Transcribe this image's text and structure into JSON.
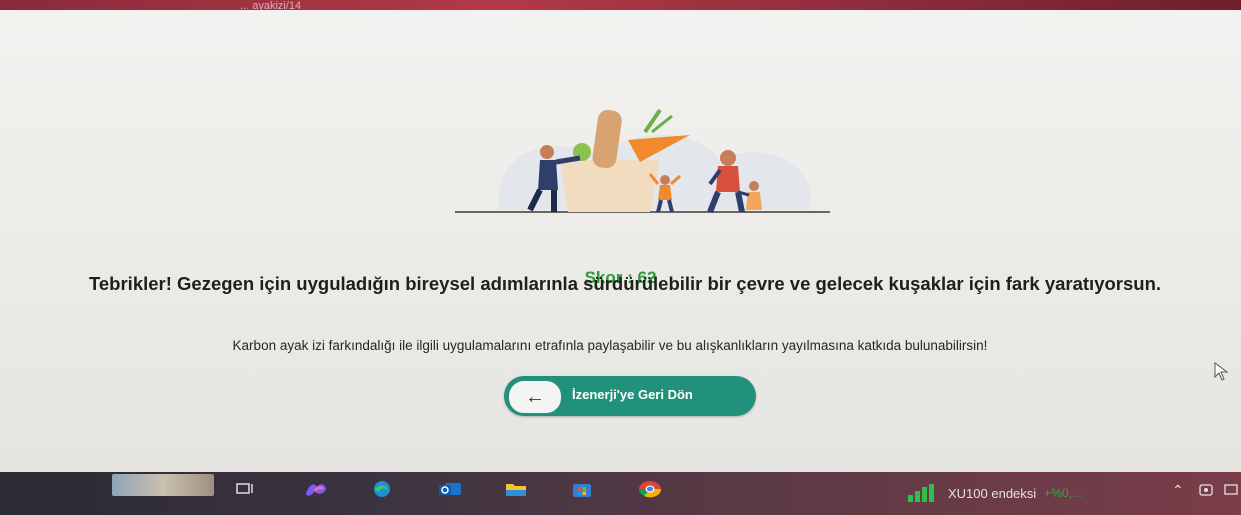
{
  "window": {
    "title": "... ayakizi/14"
  },
  "page": {
    "score_text": "Skor : 62",
    "headline": "Tebrikler! Gezegen için uyguladığın bireysel adımlarınla sürdürülebilir bir çevre ve gelecek kuşaklar için fark yaratıyorsun.",
    "subtext": "Karbon ayak izi farkındalığı ile ilgili uygulamalarını etrafınla paylaşabilir ve bu alışkanlıkların yayılmasına katkıda bulunabilirsin!",
    "back_button": {
      "icon": "arrow-left-icon",
      "label": "İzenerji'ye Geri Dön"
    }
  },
  "colors": {
    "accent": "#22917c",
    "score": "#2e9a3a",
    "text": "#1f1f1f"
  },
  "taskbar": {
    "items": [
      "task-view-icon",
      "copilot-icon",
      "edge-icon",
      "outlook-icon",
      "file-explorer-icon",
      "microsoft-store-icon",
      "chrome-icon"
    ],
    "market_name": "XU100 endeksi",
    "market_change": "+%0,..."
  }
}
